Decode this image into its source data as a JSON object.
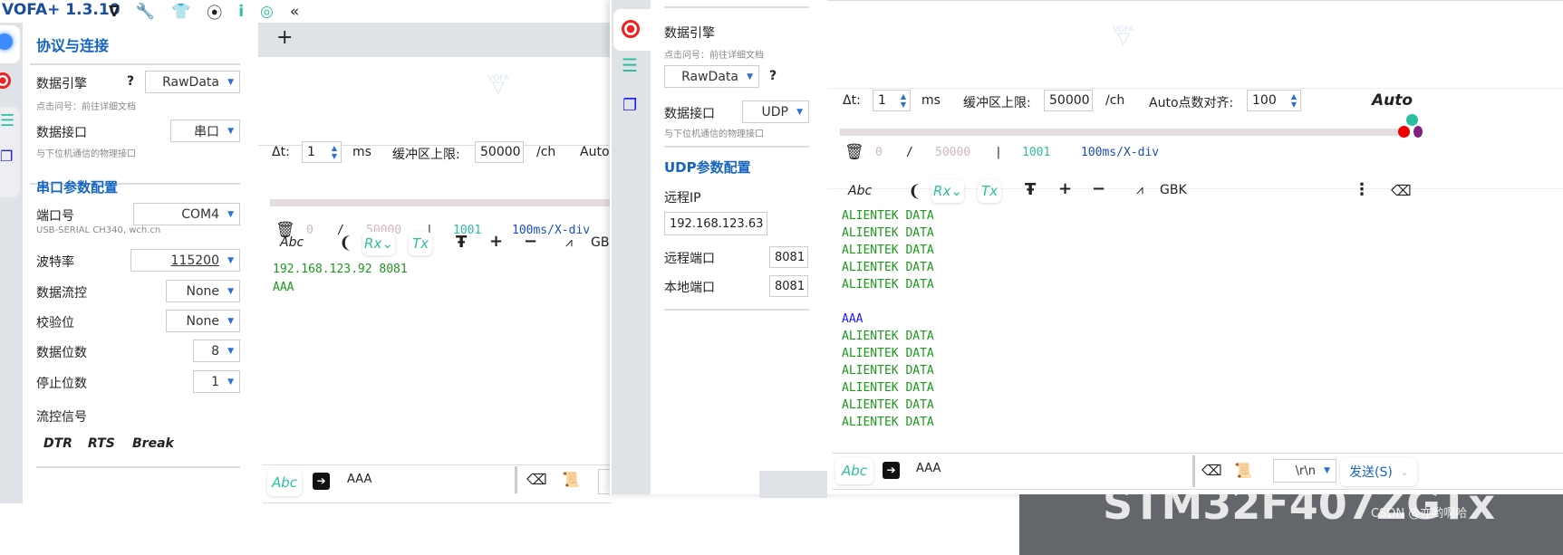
{
  "app_title": "VOFA+ 1.3.10",
  "colors": {
    "accent": "#1565c0",
    "teal": "#2bbf9f",
    "received_text": "#1a9a1a",
    "sent_text": "#1a1aff",
    "progress_bg": "#e6dde1"
  },
  "topbar_icons": [
    "vofa-logo-icon",
    "wrench-icon",
    "shirt-icon",
    "screenshot-icon",
    "info-icon",
    "fingerprint-icon",
    "collapse-icon"
  ],
  "left": {
    "panel_title": "协议与连接",
    "engine_label": "数据引擎",
    "engine_help": "?",
    "engine_value": "RawData",
    "engine_hint": "点击问号：前往详细文档",
    "interface_label": "数据接口",
    "interface_value": "串口",
    "interface_hint": "与下位机通信的物理接口",
    "section_title": "串口参数配置",
    "params": [
      {
        "label": "端口号",
        "value": "COM4",
        "hint": "USB-SERIAL CH340, wch.cn"
      },
      {
        "label": "波特率",
        "value": "115200"
      },
      {
        "label": "数据流控",
        "value": "None"
      },
      {
        "label": "校验位",
        "value": "None"
      },
      {
        "label": "数据位数",
        "value": "8"
      },
      {
        "label": "停止位数",
        "value": "1"
      }
    ],
    "flow_label": "流控信号",
    "flow_buttons": [
      "DTR",
      "RTS",
      "Break"
    ],
    "tab_add": "+",
    "logo_text": "VOFA",
    "dt_label": "Δt:",
    "dt_value": "1",
    "dt_unit": "ms",
    "buf_label": "缓冲区上限:",
    "buf_value": "50000",
    "buf_unit": "/ch",
    "auto_label": "Auto",
    "status": {
      "count": "0",
      "sep": "/",
      "max": "50000",
      "bar": "|",
      "points": "1001",
      "div": "100ms/X-div"
    },
    "toolbar": {
      "abc": "Abc",
      "rx": "Rx",
      "tx": "Tx",
      "encoding": "GBK"
    },
    "received": [
      "192.168.123.92 8081",
      "AAA"
    ],
    "send_mode": "Abc",
    "send_text": "AAA"
  },
  "right": {
    "engine_label": "数据引擎",
    "engine_hint": "点击问号：前往详细文档",
    "engine_value": "RawData",
    "engine_help": "?",
    "interface_label": "数据接口",
    "interface_value": "UDP",
    "interface_hint": "与下位机通信的物理接口",
    "section_title": "UDP参数配置",
    "remote_ip_label": "远程IP",
    "remote_ip": "192.168.123.63",
    "remote_port_label": "远程端口",
    "remote_port": "8081",
    "local_port_label": "本地端口",
    "local_port": "8081",
    "logo_text": "VOFA",
    "dt_label": "Δt:",
    "dt_value": "1",
    "dt_unit": "ms",
    "buf_label": "缓冲区上限:",
    "buf_value": "50000",
    "buf_unit": "/ch",
    "align_label": "Auto点数对齐:",
    "align_value": "100",
    "auto_label": "Auto",
    "status": {
      "count": "0",
      "sep": "/",
      "max": "50000",
      "bar": "|",
      "points": "1001",
      "div": "100ms/X-div"
    },
    "toolbar": {
      "abc": "Abc",
      "rx": "Rx",
      "tx": "Tx",
      "encoding": "GBK"
    },
    "received": [
      {
        "text": "ALIENTEK DATA",
        "type": "rx"
      },
      {
        "text": "ALIENTEK DATA",
        "type": "rx"
      },
      {
        "text": "ALIENTEK DATA",
        "type": "rx"
      },
      {
        "text": "ALIENTEK DATA",
        "type": "rx"
      },
      {
        "text": "ALIENTEK DATA",
        "type": "rx"
      },
      {
        "text": "",
        "type": "rx"
      },
      {
        "text": "AAA",
        "type": "tx"
      },
      {
        "text": "ALIENTEK DATA",
        "type": "rx"
      },
      {
        "text": "ALIENTEK DATA",
        "type": "rx"
      },
      {
        "text": "ALIENTEK DATA",
        "type": "rx"
      },
      {
        "text": "ALIENTEK DATA",
        "type": "rx"
      },
      {
        "text": "ALIENTEK DATA",
        "type": "rx"
      },
      {
        "text": "ALIENTEK DATA",
        "type": "rx"
      }
    ],
    "send_mode": "Abc",
    "send_text": "AAA",
    "line_ending": "\\r\\n",
    "send_button": "发送(S)"
  },
  "background_text": "STM32F407ZGTx",
  "watermark": "CSDN @亦哟啊哈"
}
